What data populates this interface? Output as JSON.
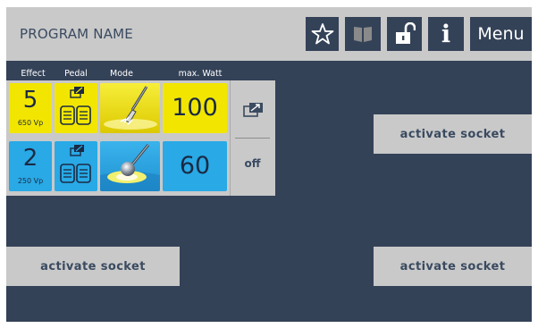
{
  "header": {
    "program_name": "PROGRAM NAME",
    "menu_label": "Menu",
    "info_label": "i",
    "icons": [
      "star-icon",
      "book-icon",
      "unlock-icon",
      "info-icon"
    ]
  },
  "columns": {
    "effect": "Effect",
    "pedal": "Pedal",
    "mode": "Mode",
    "max_watt": "max. Watt"
  },
  "channels": [
    {
      "effect": "5",
      "voltage": "650 Vp",
      "watt": "100",
      "color": "#f2e600",
      "mode_icon": "cutting-blade-icon",
      "pedal_icon": "pedal-assign-icon"
    },
    {
      "effect": "2",
      "voltage": "250 Vp",
      "watt": "60",
      "color": "#29a9e6",
      "mode_icon": "ball-electrode-icon",
      "pedal_icon": "pedal-assign-icon"
    }
  ],
  "side": {
    "swap_icon": "swap-icon",
    "off_label": "off"
  },
  "sockets": {
    "right_top": "activate socket",
    "left_bottom": "activate socket",
    "right_bottom": "activate socket"
  },
  "colors": {
    "background": "#344258",
    "bar": "#c9c9c9",
    "yellow": "#f2e600",
    "blue": "#29a9e6"
  }
}
